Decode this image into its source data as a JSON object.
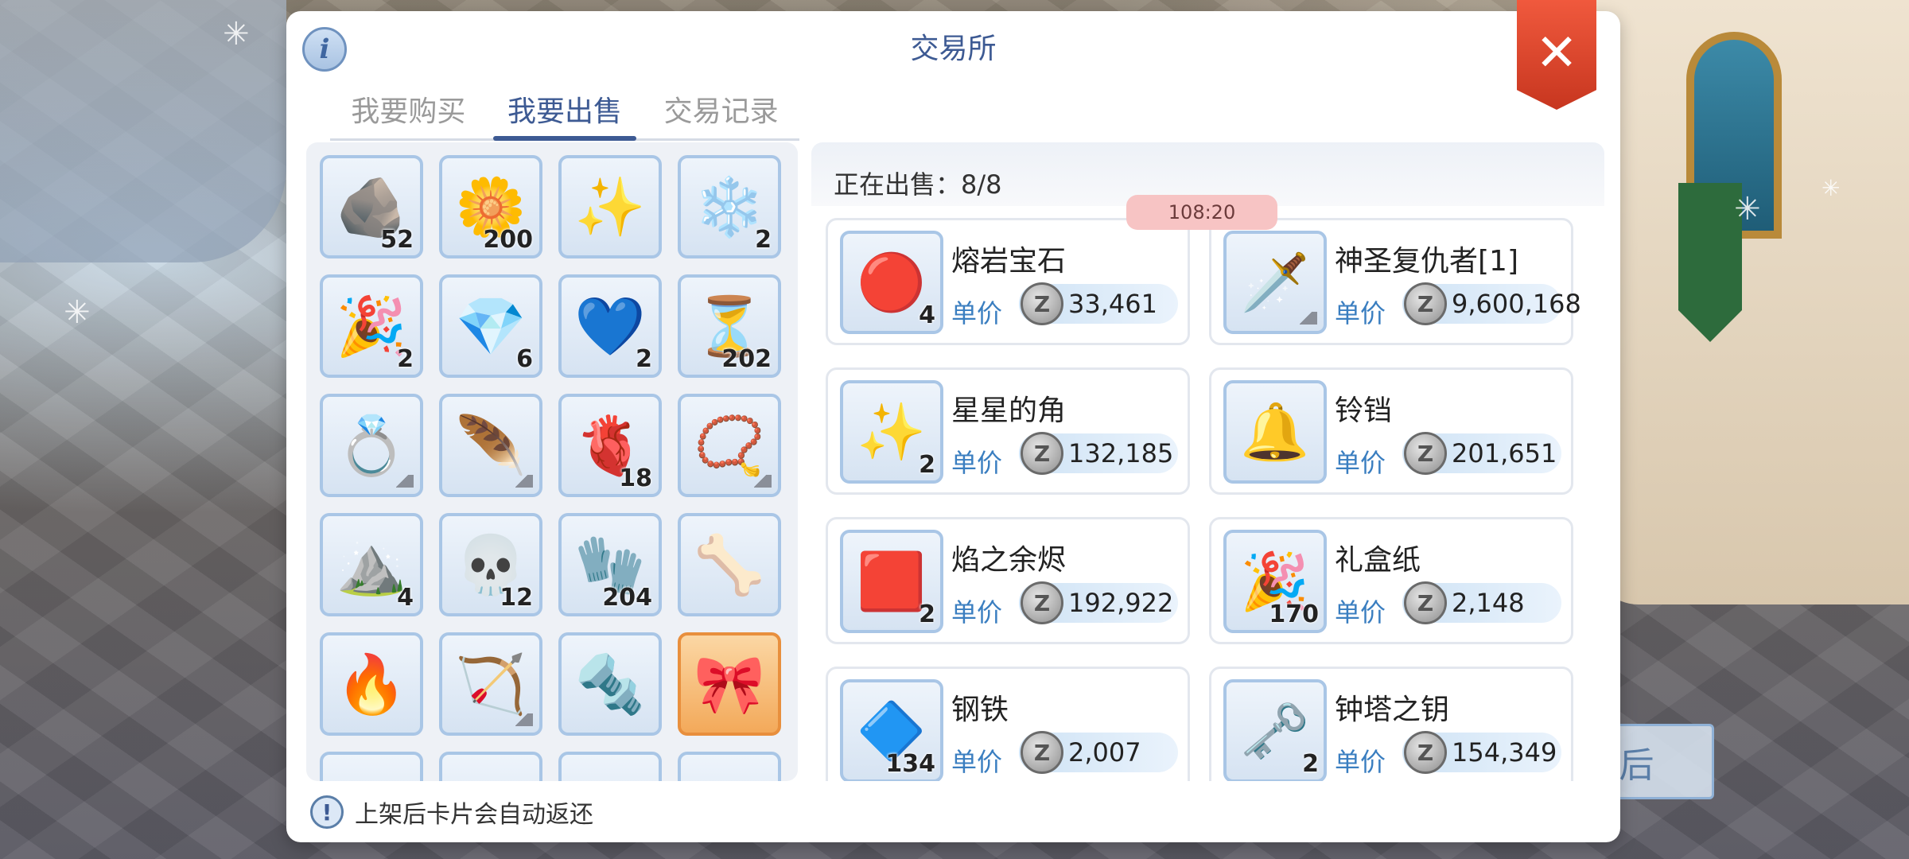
{
  "window": {
    "title": "交易所",
    "info_icon": "info-icon",
    "close_icon": "close-icon",
    "close_glyph": "✕",
    "info_glyph": "i"
  },
  "tabs": [
    {
      "label": "我要购买",
      "active": false
    },
    {
      "label": "我要出售",
      "active": true
    },
    {
      "label": "交易记录",
      "active": false
    }
  ],
  "inventory": {
    "items": [
      {
        "icon": "coal-ore-icon",
        "glyph": "🪨",
        "count": "52"
      },
      {
        "icon": "flower-icon",
        "glyph": "🌼",
        "count": "200"
      },
      {
        "icon": "star-crumb-icon",
        "glyph": "✨",
        "count": ""
      },
      {
        "icon": "snow-pile-icon",
        "glyph": "❄️",
        "count": "2"
      },
      {
        "icon": "gift-wrapping-icon",
        "glyph": "🎉",
        "count": "2"
      },
      {
        "icon": "crystal-shard-icon",
        "glyph": "💎",
        "count": "6"
      },
      {
        "icon": "ice-heart-icon",
        "glyph": "💙",
        "count": "2"
      },
      {
        "icon": "sand-pouch-icon",
        "glyph": "⏳",
        "count": "202"
      },
      {
        "icon": "ring-icon",
        "glyph": "💍",
        "count": "",
        "equip": true
      },
      {
        "icon": "feather-icon",
        "glyph": "🪶",
        "count": "",
        "equip": true
      },
      {
        "icon": "heart-organ-icon",
        "glyph": "🫀",
        "count": "18"
      },
      {
        "icon": "necklace-icon",
        "glyph": "📿",
        "count": "",
        "equip": true
      },
      {
        "icon": "dark-powder-icon",
        "glyph": "⛰️",
        "count": "4"
      },
      {
        "icon": "skull-mask-icon",
        "glyph": "💀",
        "count": "12"
      },
      {
        "icon": "glove-icon",
        "glyph": "🧤",
        "count": "204"
      },
      {
        "icon": "claw-icon",
        "glyph": "🦴",
        "count": ""
      },
      {
        "icon": "fire-chest-icon",
        "glyph": "🔥",
        "count": ""
      },
      {
        "icon": "bow-icon",
        "glyph": "🏹",
        "count": "",
        "equip": true
      },
      {
        "icon": "nail-icon",
        "glyph": "🔩",
        "count": ""
      },
      {
        "icon": "ribbon-card-icon",
        "glyph": "🎀",
        "count": "",
        "selected": true
      }
    ]
  },
  "selling": {
    "header": "正在出售：8/8",
    "price_label": "单价",
    "zeny_glyph": "Z",
    "timer": "108:20",
    "items": [
      {
        "name": "熔岩宝石",
        "count": "4",
        "price": "33,461",
        "icon": "lava-gem-icon",
        "glyph": "🔴"
      },
      {
        "name": "神圣复仇者[1]",
        "count": "",
        "price": "9,600,168",
        "icon": "holy-sword-icon",
        "glyph": "🗡️",
        "equip": true
      },
      {
        "name": "星星的角",
        "count": "2",
        "price": "132,185",
        "icon": "star-crumb-icon",
        "glyph": "✨"
      },
      {
        "name": "铃铛",
        "count": "",
        "price": "201,651",
        "icon": "bell-icon",
        "glyph": "🔔"
      },
      {
        "name": "焰之余烬",
        "count": "2",
        "price": "192,922",
        "icon": "ember-icon",
        "glyph": "🟥"
      },
      {
        "name": "礼盒纸",
        "count": "170",
        "price": "2,148",
        "icon": "gift-wrapping-icon",
        "glyph": "🎉"
      },
      {
        "name": "钢铁",
        "count": "134",
        "price": "2,007",
        "icon": "steel-icon",
        "glyph": "🔷"
      },
      {
        "name": "钟塔之钥",
        "count": "2",
        "price": "154,349",
        "icon": "clock-tower-key-icon",
        "glyph": "🗝️"
      }
    ]
  },
  "notice": {
    "text": "上架后卡片会自动返还",
    "icon": "exclamation-icon",
    "glyph": "!"
  },
  "background": {
    "button_text": "后"
  }
}
